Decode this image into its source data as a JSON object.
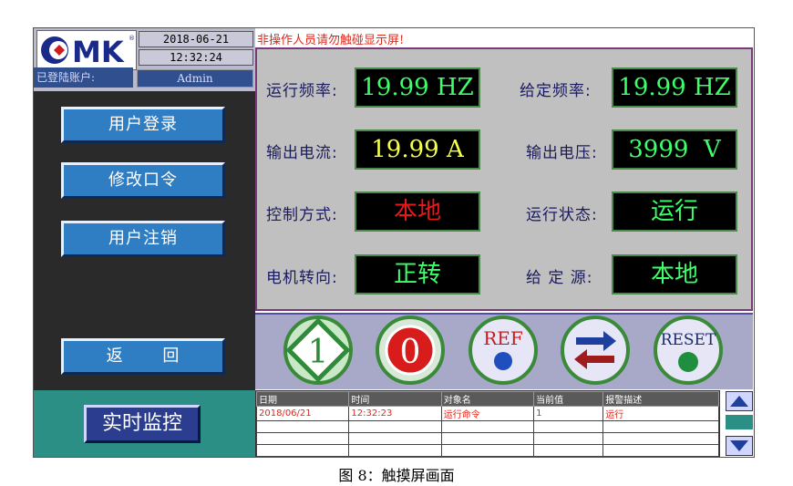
{
  "header": {
    "logo_text": "CMK",
    "date": "2018-06-21",
    "time": "12:32:24",
    "account_label": "已登陆账户:",
    "account_value": "Admin",
    "warning": "非操作人员请勿触碰显示屏!"
  },
  "menu": {
    "login": "用户登录",
    "change_password": "修改口令",
    "logout": "用户注销",
    "back": "返 回",
    "monitor": "实时监控"
  },
  "params": [
    {
      "label": "运行频率:",
      "value": "19.99 HZ"
    },
    {
      "label": "给定频率:",
      "value": "19.99 HZ"
    },
    {
      "label": "输出电流:",
      "value": "19.99 A"
    },
    {
      "label": "输出电压:",
      "value": "3999  V"
    },
    {
      "label": "控制方式:",
      "value": "本地"
    },
    {
      "label": "运行状态:",
      "value": "运行"
    },
    {
      "label": "电机转向:",
      "value": "正转"
    },
    {
      "label": "给 定 源:",
      "value": "本地"
    }
  ],
  "controls": {
    "start_label": "1",
    "stop_label": "0",
    "ref_label": "REF",
    "direction_icon": "arrows-left-right-icon",
    "reset_label": "RESET"
  },
  "alarm_table": {
    "headers": [
      "日期",
      "时间",
      "对象名",
      "当前值",
      "报警描述"
    ],
    "rows": [
      [
        "2018/06/21",
        "12:32:23",
        "运行命令",
        "1",
        "运行"
      ]
    ]
  },
  "caption": "图 8：触摸屏画面",
  "colors": {
    "display_green": "#3cff6a",
    "display_yellow": "#f6ff4a",
    "display_red": "#e8181a",
    "button_blue": "#2f7dc2",
    "teal": "#2b8f86"
  }
}
